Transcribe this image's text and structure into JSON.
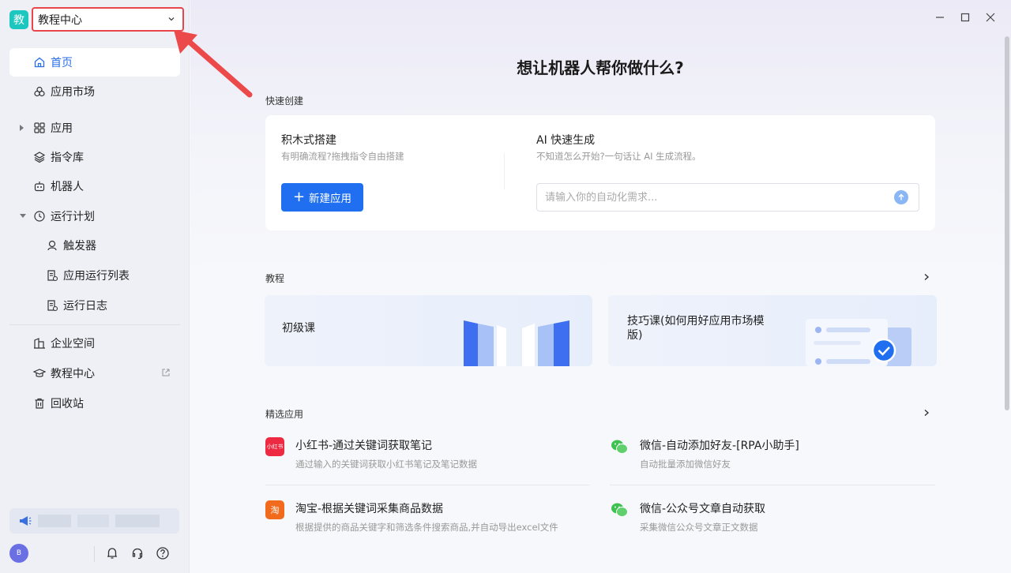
{
  "sidebar": {
    "workspace": {
      "logo_char": "教",
      "name": "教程中心"
    },
    "items": [
      {
        "label": "首页"
      },
      {
        "label": "应用市场"
      },
      {
        "label": "应用"
      },
      {
        "label": "指令库"
      },
      {
        "label": "机器人"
      },
      {
        "label": "运行计划"
      },
      {
        "label": "触发器"
      },
      {
        "label": "应用运行列表"
      },
      {
        "label": "运行日志"
      },
      {
        "label": "企业空间"
      },
      {
        "label": "教程中心"
      },
      {
        "label": "回收站"
      }
    ],
    "avatar_initial": "B"
  },
  "main": {
    "hero_title": "想让机器人帮你做什么?",
    "quick_create": {
      "section_title": "快速创建",
      "block": {
        "title": "积木式搭建",
        "subtitle": "有明确流程?拖拽指令自由搭建",
        "button_label": "新建应用"
      },
      "ai": {
        "title": "AI 快速生成",
        "subtitle": "不知道怎么开始?一句话让 AI 生成流程。",
        "placeholder": "请输入你的自动化需求..."
      }
    },
    "tutorials": {
      "section_title": "教程",
      "cards": [
        {
          "label": "初级课"
        },
        {
          "label": "技巧课(如何用好应用市场模版)"
        }
      ]
    },
    "featured": {
      "section_title": "精选应用",
      "apps": [
        {
          "icon_text": "小红书",
          "title": "小红书-通过关键词获取笔记",
          "desc": "通过输入的关键词获取小红书笔记及笔记数据"
        },
        {
          "icon_text": "",
          "title": "微信-自动添加好友-[RPA小助手]",
          "desc": "自动批量添加微信好友"
        },
        {
          "icon_text": "淘",
          "title": "淘宝-根据关键词采集商品数据",
          "desc": "根据提供的商品关键字和筛选条件搜索商品,并自动导出excel文件"
        },
        {
          "icon_text": "",
          "title": "微信-公众号文章自动获取",
          "desc": "采集微信公众号文章正文数据"
        }
      ]
    }
  },
  "colors": {
    "accent": "#1f6ff0",
    "active_text": "#2a6fe8",
    "highlight_border": "#e8464a",
    "xhs": "#ee2a43",
    "taobao": "#f26b1d",
    "wechat": "#3ec150"
  }
}
